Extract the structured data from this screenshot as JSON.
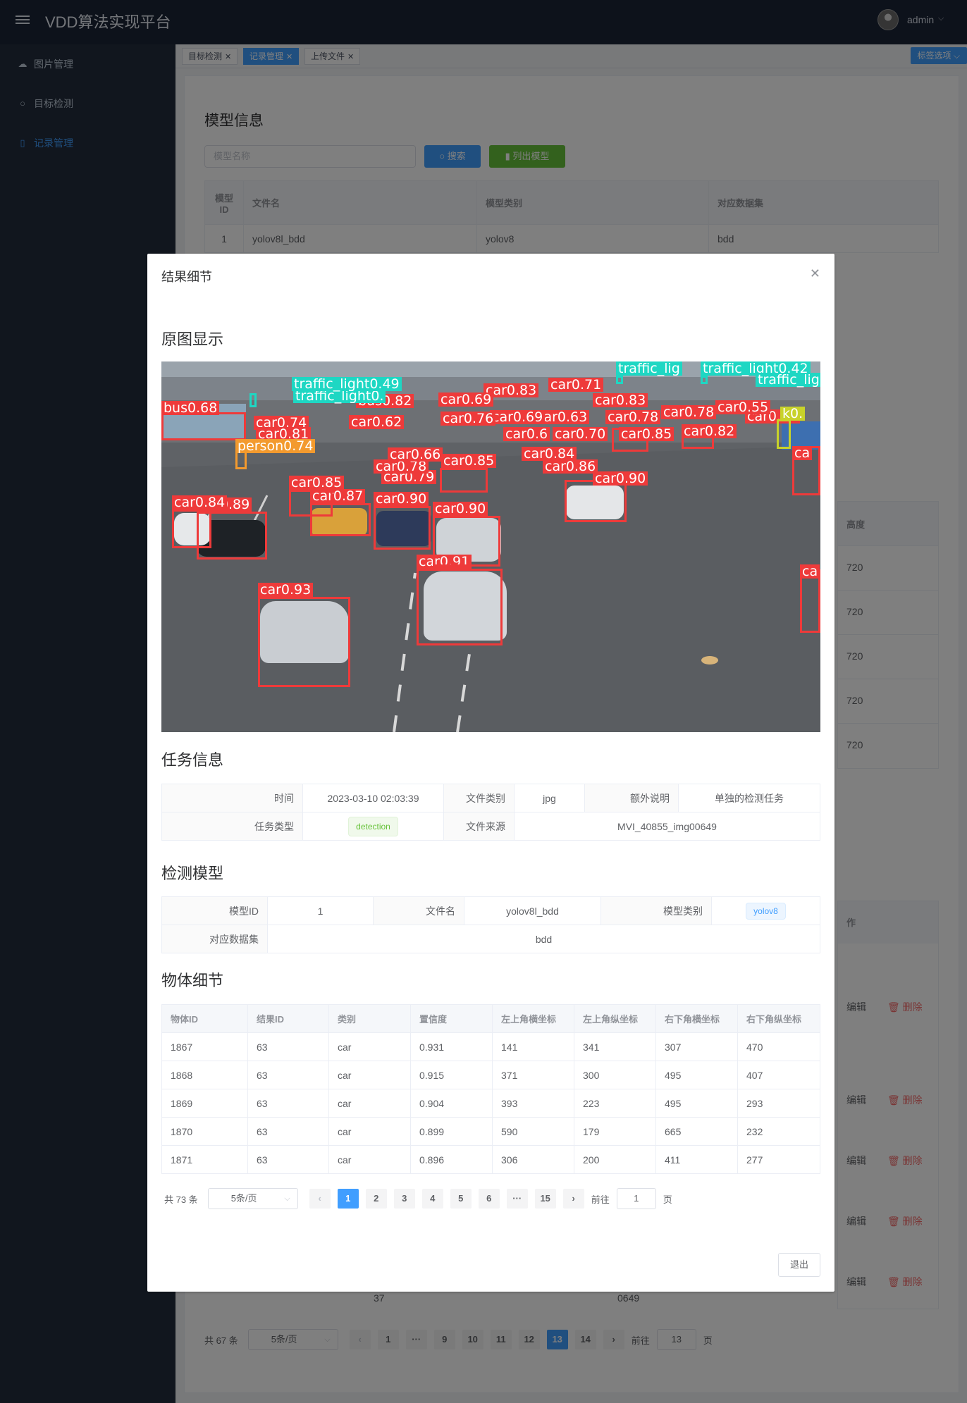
{
  "app": {
    "title": "VDD算法实现平台",
    "user": "admin"
  },
  "sidebar": {
    "items": [
      {
        "label": "图片管理",
        "icon": "cloud-icon"
      },
      {
        "label": "目标检测",
        "icon": "search-icon"
      },
      {
        "label": "记录管理",
        "icon": "document-icon",
        "active": true
      }
    ]
  },
  "tags": {
    "items": [
      {
        "label": "目标检测"
      },
      {
        "label": "记录管理",
        "active": true
      },
      {
        "label": "上传文件"
      }
    ],
    "options_label": "标签选项"
  },
  "background": {
    "model_title": "模型信息",
    "search_placeholder": "模型名称",
    "search_btn": "搜索",
    "list_btn": "列出模型",
    "model_headers": [
      "模型ID",
      "文件名",
      "模型类别",
      "对应数据集"
    ],
    "model_row": [
      "1",
      "yolov8l_bdd",
      "yolov8",
      "bdd"
    ],
    "height_header": "高度",
    "height_values": [
      "720",
      "720",
      "720",
      "720",
      "720"
    ],
    "op_header": "作",
    "edit_label": "编辑",
    "delete_label": "删除",
    "fragment_37": "37",
    "fragment_0649": "0649",
    "pager": {
      "total": "共 67 条",
      "size": "5条/页",
      "pages": [
        "1",
        "···",
        "9",
        "10",
        "11",
        "12",
        "13",
        "14"
      ],
      "current": "13",
      "goto": "前往",
      "goto_value": "13",
      "page_unit": "页"
    }
  },
  "dialog": {
    "title": "结果细节",
    "original_title": "原图显示",
    "task_title": "任务信息",
    "task": {
      "time_label": "时间",
      "time": "2023-03-10 02:03:39",
      "filetype_label": "文件类别",
      "filetype": "jpg",
      "note_label": "额外说明",
      "note": "单独的检测任务",
      "type_label": "任务类型",
      "type": "detection",
      "source_label": "文件来源",
      "source": "MVI_40855_img00649"
    },
    "model_title": "检测模型",
    "model": {
      "id_label": "模型ID",
      "id": "1",
      "file_label": "文件名",
      "file": "yolov8l_bdd",
      "cat_label": "模型类别",
      "cat": "yolov8",
      "ds_label": "对应数据集",
      "ds": "bdd"
    },
    "objects_title": "物体细节",
    "objects": {
      "headers": [
        "物体ID",
        "结果ID",
        "类别",
        "置信度",
        "左上角横坐标",
        "左上角纵坐标",
        "右下角横坐标",
        "右下角纵坐标"
      ],
      "rows": [
        [
          "1867",
          "63",
          "car",
          "0.931",
          "141",
          "341",
          "307",
          "470"
        ],
        [
          "1868",
          "63",
          "car",
          "0.915",
          "371",
          "300",
          "495",
          "407"
        ],
        [
          "1869",
          "63",
          "car",
          "0.904",
          "393",
          "223",
          "495",
          "293"
        ],
        [
          "1870",
          "63",
          "car",
          "0.899",
          "590",
          "179",
          "665",
          "232"
        ],
        [
          "1871",
          "63",
          "car",
          "0.896",
          "306",
          "200",
          "411",
          "277"
        ]
      ]
    },
    "pager": {
      "total": "共 73 条",
      "size": "5条/页",
      "pages": [
        "1",
        "2",
        "3",
        "4",
        "5",
        "6",
        "···",
        "15"
      ],
      "current": "1",
      "goto": "前往",
      "goto_value": "1",
      "page_unit": "页"
    },
    "quit_label": "退出",
    "detections": [
      "traffic_light0.49",
      "traffic_light0.",
      "traffic_light0.42",
      "traffic_lig",
      "traffic_lig",
      "bus0.68",
      "bus0.82",
      "car0.74",
      "car0.81",
      "car0.62",
      "car0.83",
      "car0.76",
      "car0.69",
      "car0.63",
      "car0.78",
      "car0.83",
      "car0.78",
      "car0.81",
      "car0.71",
      "car0.87",
      "car0.85",
      "car0.82",
      "car0.66",
      "car0.78",
      "car0.79",
      "car0.85",
      "car0.84",
      "car0.86",
      "car0.90",
      "car0.85",
      "car0.87",
      "car0.90",
      "car0.84",
      "car0.89",
      "car0.90",
      "car0.91",
      "car0.93",
      "person0.74",
      "car0.6",
      "car0.70",
      "car0.55",
      "ca",
      "ca",
      "k0."
    ]
  }
}
